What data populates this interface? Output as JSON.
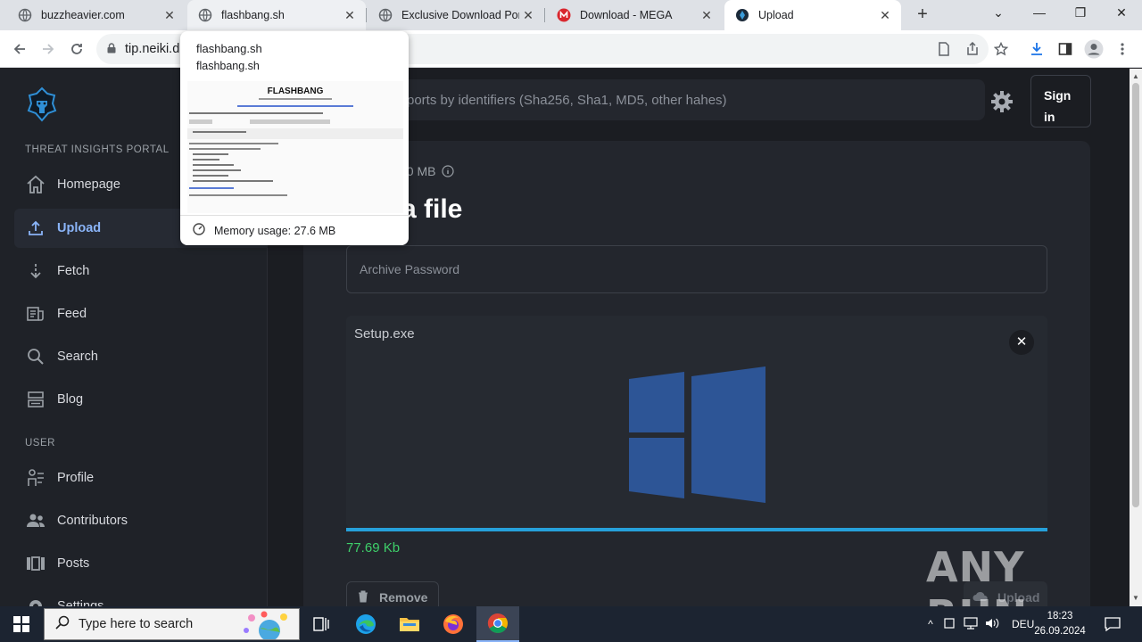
{
  "browser": {
    "tabs": [
      {
        "title": "buzzheavier.com",
        "close": "✕"
      },
      {
        "title": "flashbang.sh",
        "close": "✕"
      },
      {
        "title": "Exclusive Download Port",
        "close": "✕"
      },
      {
        "title": "Download - MEGA",
        "close": "✕"
      },
      {
        "title": "Upload",
        "close": "✕"
      }
    ],
    "new_tab": "+",
    "window_controls": {
      "dropdown": "⌄",
      "minimize": "—",
      "restore": "❐",
      "close": "✕"
    },
    "url": "tip.neiki.d",
    "hover_card": {
      "title": "flashbang.sh",
      "domain": "flashbang.sh",
      "thumb_heading": "FLASHBANG",
      "memory": "Memory usage: 27.6 MB"
    }
  },
  "sidebar": {
    "portal_label": "THREAT INSIGHTS PORTAL",
    "items": [
      {
        "label": "Homepage",
        "icon": "home-icon"
      },
      {
        "label": "Upload",
        "icon": "upload-icon"
      },
      {
        "label": "Fetch",
        "icon": "fetch-icon"
      },
      {
        "label": "Feed",
        "icon": "feed-icon"
      },
      {
        "label": "Search",
        "icon": "search-icon"
      },
      {
        "label": "Blog",
        "icon": "blog-icon"
      }
    ],
    "user_label": "USER",
    "user_items": [
      {
        "label": "Profile",
        "icon": "profile-icon"
      },
      {
        "label": "Contributors",
        "icon": "contributors-icon"
      },
      {
        "label": "Posts",
        "icon": "posts-icon"
      },
      {
        "label": "Settings",
        "icon": "settings-icon"
      }
    ]
  },
  "header": {
    "search_placeholder": "ports by identifiers (Sha256, Sha1, MD5, other hahes)",
    "signin_line1": "Sign",
    "signin_line2": "in"
  },
  "main": {
    "size_info": "00 MB",
    "heading": "a file",
    "password_placeholder": "Archive Password",
    "file_name": "Setup.exe",
    "progress_fraction": 1.0,
    "uploaded_size": "77.69 Kb",
    "remove_label": "Remove",
    "upload_label": "Upload",
    "watermark": "ANY RUN"
  },
  "taskbar": {
    "search_placeholder": "Type here to search",
    "language": "DEU",
    "time": "18:23",
    "date": "26.09.2024"
  }
}
